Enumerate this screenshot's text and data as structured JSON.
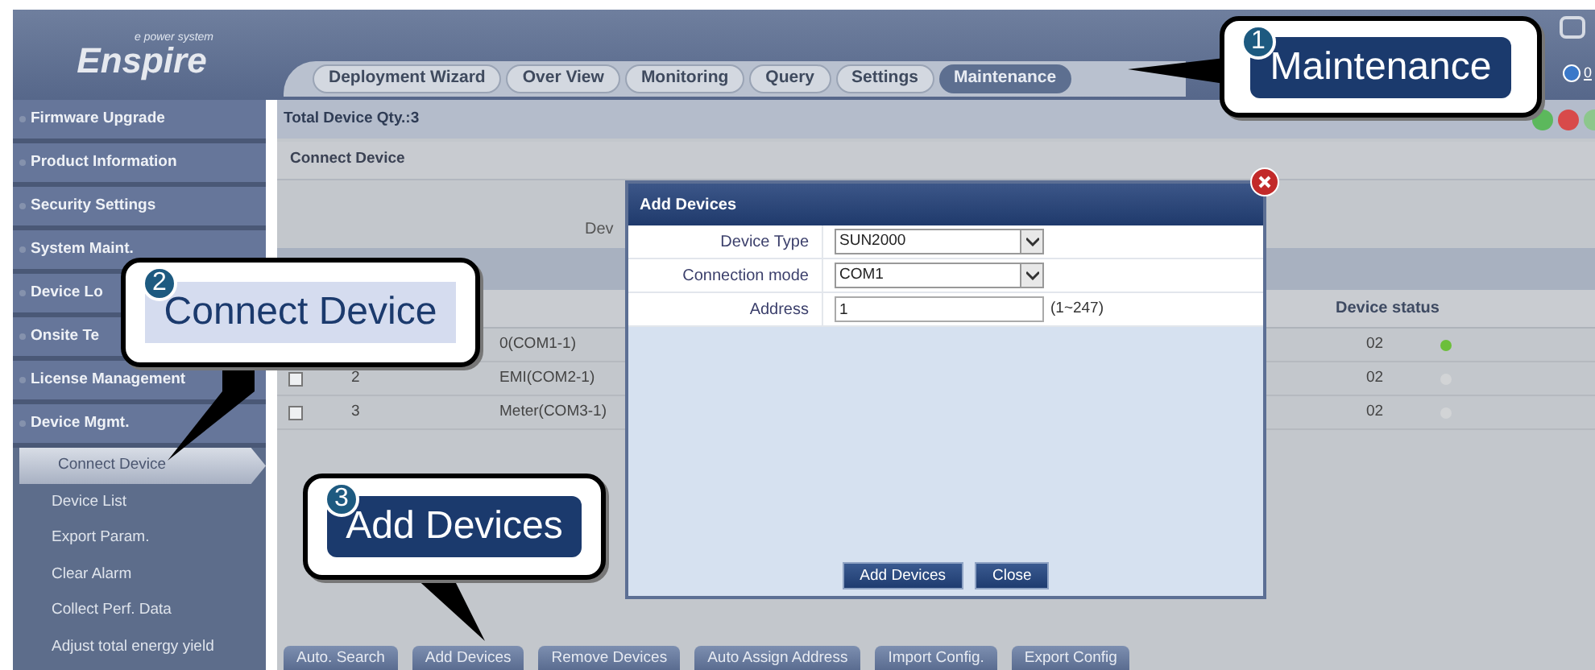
{
  "header": {
    "logo": "Enspire",
    "tagline": "e power system",
    "alarm_count": "0"
  },
  "tabs": [
    {
      "label": "Deployment Wizard",
      "selected": false
    },
    {
      "label": "Over View",
      "selected": false
    },
    {
      "label": "Monitoring",
      "selected": false
    },
    {
      "label": "Query",
      "selected": false
    },
    {
      "label": "Settings",
      "selected": false
    },
    {
      "label": "Maintenance",
      "selected": true
    }
  ],
  "sidebar": {
    "items": [
      {
        "label": "Firmware Upgrade"
      },
      {
        "label": "Product Information"
      },
      {
        "label": "Security Settings"
      },
      {
        "label": "System Maint."
      },
      {
        "label": "Device Lo"
      },
      {
        "label": "Onsite Te"
      },
      {
        "label": "License Management"
      },
      {
        "label": "Device Mgmt.",
        "children": [
          {
            "label": "Connect Device",
            "selected": true
          },
          {
            "label": "Device List",
            "selected": false
          },
          {
            "label": "Export Param.",
            "selected": false
          },
          {
            "label": "Clear Alarm",
            "selected": false
          },
          {
            "label": "Collect Perf. Data",
            "selected": false
          },
          {
            "label": "Adjust total energy yield",
            "selected": false
          }
        ]
      }
    ]
  },
  "main": {
    "total": "Total Device Qty.:3",
    "panel_title": "Connect Device",
    "partial_text": "Dev",
    "table": {
      "status_heading": "Device status",
      "rows": [
        {
          "name": "0(COM1-1)",
          "column_4": "02",
          "color": "#6cbf3a"
        },
        {
          "checked": false,
          "number": "2",
          "name": "EMI(COM2-1)",
          "column_4": "02",
          "color": "#d2d4d6"
        },
        {
          "checked": false,
          "number": "3",
          "name": "Meter(COM3-1)",
          "column_4": "02",
          "color": "#d2d4d6"
        }
      ]
    }
  },
  "dialog": {
    "title": "Add Devices",
    "fields": [
      {
        "kind": "select",
        "label": "Device Type",
        "value": "SUN2000"
      },
      {
        "kind": "select",
        "label": "Connection mode",
        "value": "COM1"
      },
      {
        "kind": "input",
        "label": "Address",
        "value": "1",
        "hint": "(1~247)"
      }
    ],
    "buttons": [
      "Add Devices",
      "Close"
    ]
  },
  "toolbar": [
    "Auto. Search",
    "Add Devices",
    "Remove Devices",
    "Auto Assign Address",
    "Import Config.",
    "Export Config"
  ],
  "callouts": [
    {
      "number": "1",
      "text": "Maintenance",
      "kind": "dark"
    },
    {
      "number": "2",
      "text": "Connect Device",
      "kind": "light"
    },
    {
      "number": "3",
      "text": "Add Devices",
      "kind": "dark"
    }
  ]
}
